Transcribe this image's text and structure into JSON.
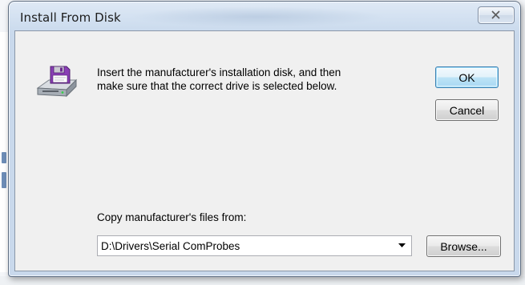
{
  "dialog": {
    "title": "Install From Disk",
    "message_line1": "Insert the manufacturer's installation disk, and then",
    "message_line2": "make sure that the correct drive is selected below.",
    "ok_label": "OK",
    "cancel_label": "Cancel",
    "copy_from_label": "Copy manufacturer's files from:",
    "path_value": "D:\\Drivers\\Serial ComProbes",
    "browse_label": "Browse..."
  },
  "icons": {
    "close": "close-icon",
    "disk": "floppy-disk-icon",
    "dropdown": "chevron-down-icon"
  },
  "colors": {
    "frame": "#c9d9ec",
    "client_bg": "#f0f0f0",
    "default_button_border": "#3c7fb1"
  }
}
